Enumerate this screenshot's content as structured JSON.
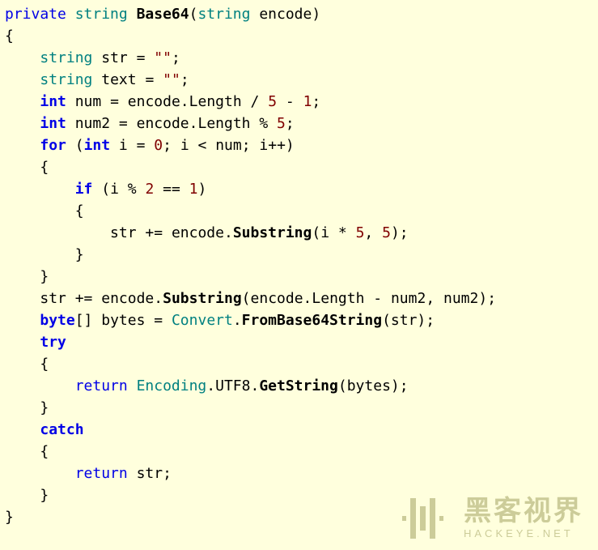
{
  "code": {
    "kw_private": "private",
    "type_string": "string",
    "mname_Base64": "Base64",
    "param_name": "encode",
    "id_str": "str",
    "id_text": "text",
    "empty_str_lit": "\"\"",
    "kw_int": "int",
    "id_num": "num",
    "id_num2": "num2",
    "prop_Length": "Length",
    "lit_5": "5",
    "lit_1": "1",
    "lit_0": "0",
    "lit_2": "2",
    "kw_for": "for",
    "id_i": "i",
    "kw_if": "if",
    "mname_Substring": "Substring",
    "kw_byte": "byte",
    "id_bytes": "bytes",
    "type_Convert": "Convert",
    "mname_FromBase64String": "FromBase64String",
    "kw_try": "try",
    "kw_return": "return",
    "type_Encoding": "Encoding",
    "id_UTF8": "UTF8",
    "mname_GetString": "GetString",
    "kw_catch": "catch"
  },
  "watermark": {
    "cn": "黑客视界",
    "en": "HACKEYE.NET"
  },
  "colors": {
    "background": "#ffffdd",
    "keyword": "#0000e6",
    "type": "#008080",
    "literal": "#800000",
    "watermark": "#cccc99"
  }
}
